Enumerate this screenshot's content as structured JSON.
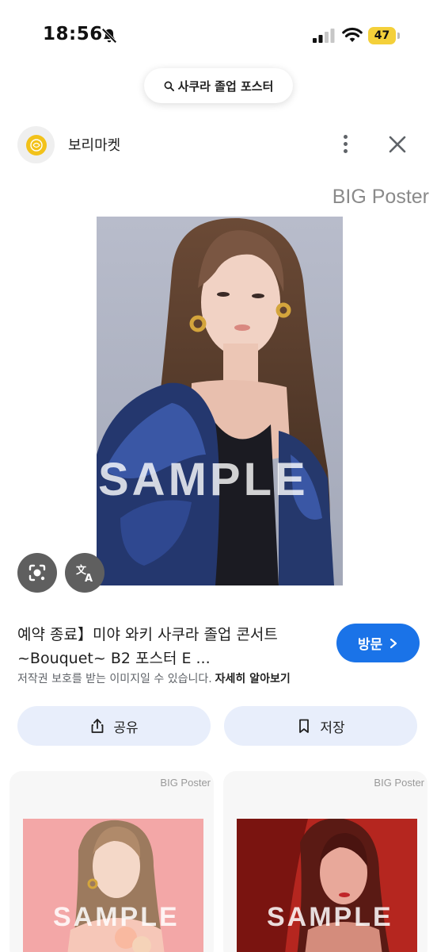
{
  "status_bar": {
    "time": "18:56",
    "battery": "47"
  },
  "search": {
    "query": "사쿠라 졸업 포스터"
  },
  "source": {
    "name": "보리마켓"
  },
  "image": {
    "brand": "BIG Poster",
    "watermark": "SAMPLE"
  },
  "result": {
    "title": "예약 종료】미야 와키 사쿠라 졸업 콘서트 ~Bouquet~ B2 포스터 E ...",
    "visit_label": "방문",
    "copyright_notice": "저작권 보호를 받는 이미지일 수 있습니다.",
    "learn_more": "자세히 알아보기"
  },
  "actions": {
    "share_label": "공유",
    "save_label": "저장"
  },
  "related": [
    {
      "brand": "BIG Poster",
      "watermark": "SAMPLE"
    },
    {
      "brand": "BIG Poster",
      "watermark": "SAMPLE"
    }
  ],
  "colors": {
    "accent": "#1a73e8",
    "action_bg": "#e8eefb",
    "battery": "#f4d03a"
  }
}
